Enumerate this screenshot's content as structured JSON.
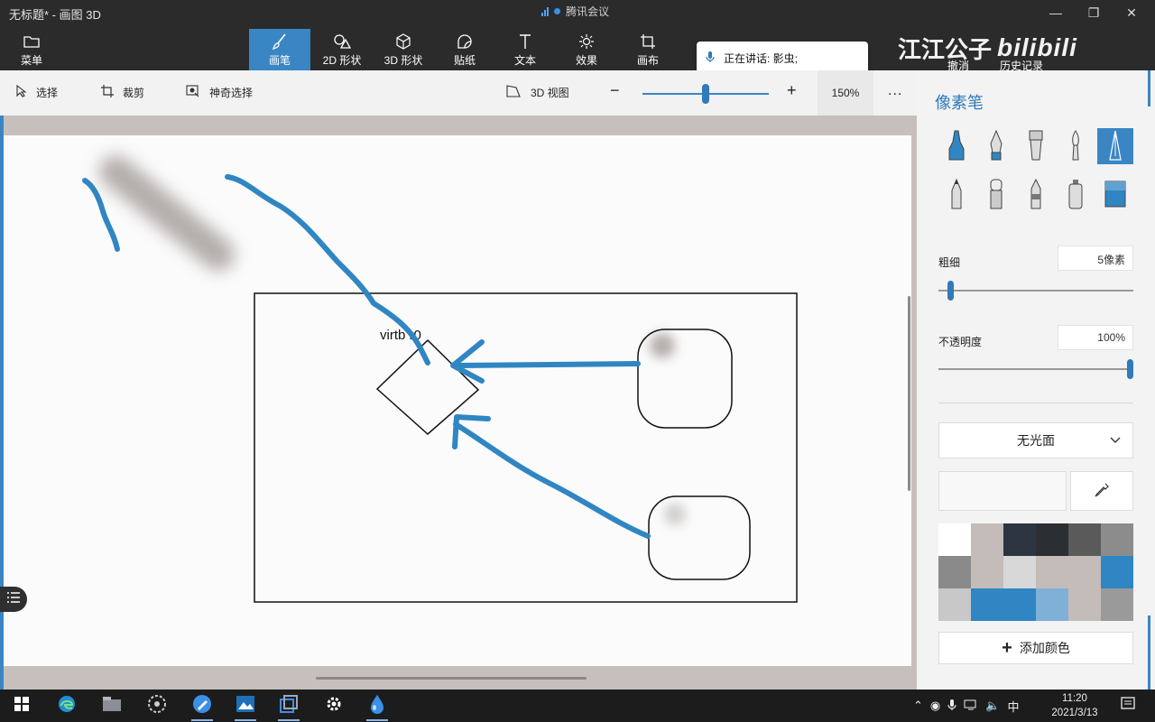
{
  "window": {
    "title": "无标题* - 画图 3D"
  },
  "meeting": {
    "app_name": "腾讯会议",
    "speaking_text": "正在讲话: 影虫;"
  },
  "watermark": {
    "text": "江江公子",
    "brand": "bilibili"
  },
  "ribbon": {
    "menu_label": "菜单",
    "tools": [
      {
        "label": "画笔",
        "icon": "brush-icon",
        "active": true
      },
      {
        "label": "2D 形状",
        "icon": "shapes-2d-icon"
      },
      {
        "label": "3D 形状",
        "icon": "cube-icon"
      },
      {
        "label": "贴纸",
        "icon": "sticker-icon"
      },
      {
        "label": "文本",
        "icon": "text-icon"
      },
      {
        "label": "效果",
        "icon": "effects-icon"
      },
      {
        "label": "画布",
        "icon": "canvas-icon"
      }
    ],
    "undo_label": "撤消",
    "history_label": "历史记录"
  },
  "toolbar": {
    "select_label": "选择",
    "crop_label": "裁剪",
    "magic_select_label": "神奇选择",
    "view3d_label": "3D 视图",
    "zoom": "150%",
    "zoom_level": 0.5,
    "more": "..."
  },
  "canvas": {
    "box_label": "virtb r0"
  },
  "panel": {
    "title": "像素笔",
    "brushes": [
      "marker-icon",
      "calligraphy-pen-icon",
      "oil-brush-icon",
      "watercolor-icon",
      "pixel-pen-icon",
      "pencil-icon",
      "eraser-icon",
      "crayon-icon",
      "spray-can-icon",
      "fill-icon"
    ],
    "selected_brush": "pixel-pen-icon",
    "thickness_label": "粗细",
    "thickness_value": "5像素",
    "thickness_level": 0.05,
    "opacity_label": "不透明度",
    "opacity_value": "100%",
    "opacity_level": 1.0,
    "finish": "无光面",
    "swatches": [
      "#ffffff",
      "#c3bcb9",
      "#2d3540",
      "#2b2f34",
      "#5a5a5a",
      "#8c8c8c",
      "#8a8a8a",
      "#c3bcb9",
      "#d8d8d8",
      "#c3bcb9",
      "#c3bcb9",
      "#2f86c2",
      "#c8c8c8",
      "#2f86c2",
      "#2f86c2",
      "#7fb0d6",
      "#c3bcb9",
      "#9a9a9a"
    ],
    "add_color_label": "添加颜色"
  },
  "taskbar": {
    "apps": [
      "edge-icon",
      "file-explorer-icon",
      "settings-wheel-icon",
      "paint-icon",
      "photos-icon",
      "vm-icon",
      "gear-icon",
      "paint3d-icon"
    ],
    "ime": "中",
    "time": "11:20",
    "date": "2021/3/13"
  },
  "colors": {
    "accent": "#3a86c4",
    "stroke": "#2f86c2"
  }
}
